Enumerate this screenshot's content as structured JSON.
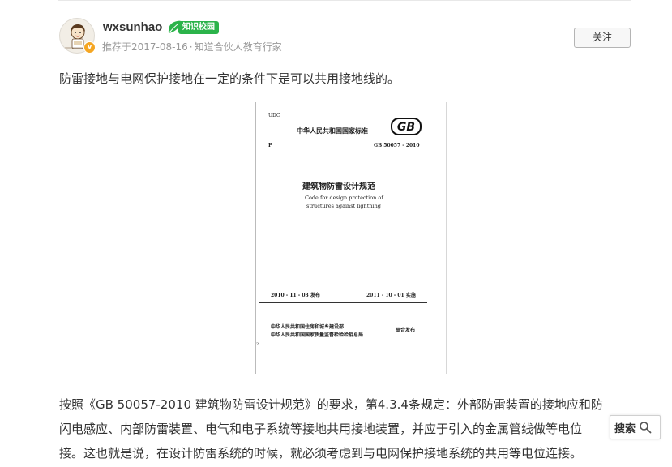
{
  "author": {
    "username": "wxsunhao",
    "tag_label": "知识校园",
    "verified_mark": "v",
    "recommend_text": "推荐于2017-08-16",
    "meta_separator": "·",
    "org_text": "知道合伙人教育行家"
  },
  "actions": {
    "follow_label": "关注"
  },
  "answer": {
    "intro": "防雷接地与电网保护接地在一定的条件下是可以共用接地线的。",
    "body_lines": [
      "按照《GB 50057-2010 建筑物防雷设计规范》的要求，第4.3.4条规定：外部防雷装置的接地应和防",
      "闪电感应、内部防雷装置、电气和电子系统等接地共用接地装置，并应于引入的金属管线做等电位",
      "接。这也就是说，在设计防雷系统的时候，就必须考虑到与电网保护接地系统的共用等电位连接。"
    ]
  },
  "document_image": {
    "udc": "UDC",
    "header": "中华人民共和国国家标准",
    "logo": "GB",
    "class_code": "P",
    "std_number": "GB 50057 - 2010",
    "title_cn": "建筑物防雷设计规范",
    "title_en_1": "Code for design protection of",
    "title_en_2": "structures against lightning",
    "issue_date": "2010 - 11 - 03  发布",
    "impl_date": "2011 - 10 - 01  实施",
    "issuer_1": "中华人民共和国住房和城乡建设部",
    "issuer_2": "中华人民共和国国家质量监督检验检疫总局",
    "joint_issue": "联合发布",
    "page_mark": "2"
  },
  "floating": {
    "search_label": "搜索"
  },
  "colors": {
    "tag_green": "#2bb34a",
    "badge_orange": "#f5a623",
    "meta_gray": "#999999",
    "text": "#333333"
  }
}
